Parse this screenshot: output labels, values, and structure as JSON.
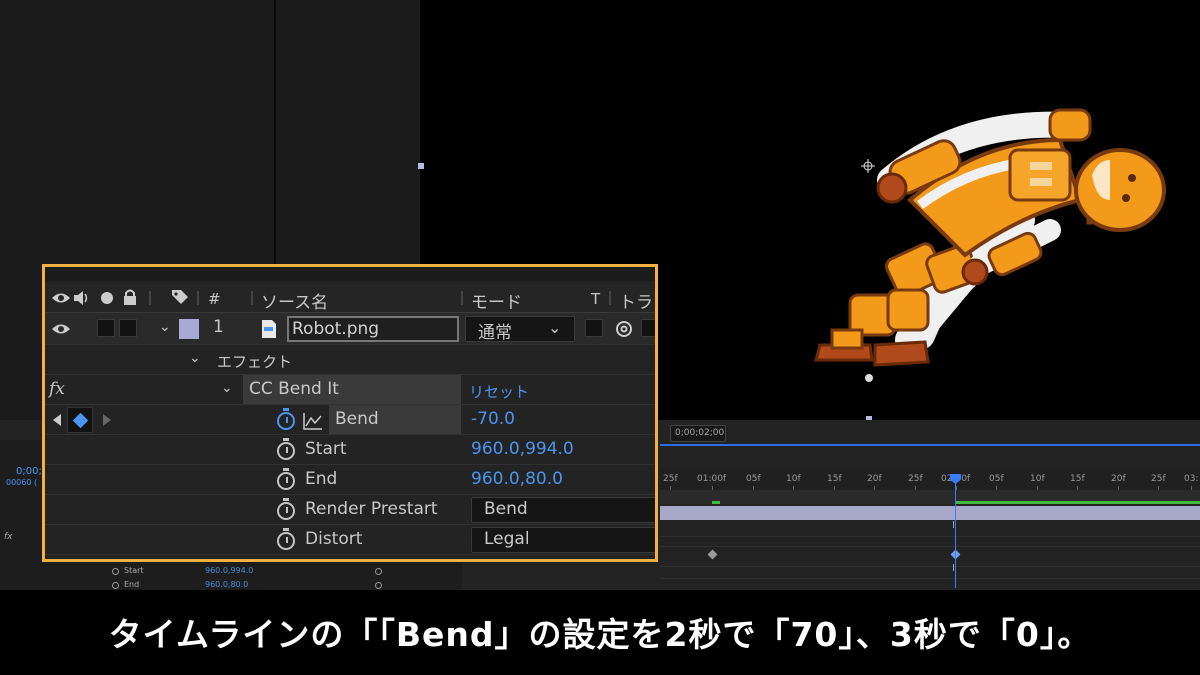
{
  "header": {
    "col_source_name": "ソース名",
    "col_mode": "モード",
    "col_t": "T",
    "col_track": "トラ",
    "col_number": "#"
  },
  "layer": {
    "number": "1",
    "name": "Robot.png",
    "mode": "通常",
    "label_color": "#a9a9d6"
  },
  "effects_group": {
    "label": "エフェクト"
  },
  "effect": {
    "fx_label": "fx",
    "name": "CC Bend It",
    "reset_label": "リセット"
  },
  "properties": [
    {
      "label": "Bend",
      "value": "-70.0"
    },
    {
      "label": "Start",
      "value": "960.0,994.0"
    },
    {
      "label": "End",
      "value": "960.0,80.0"
    },
    {
      "label": "Render Prestart",
      "value": "Bend"
    },
    {
      "label": "Distort",
      "value": "Legal"
    }
  ],
  "timeline": {
    "timecode_box": "0;00;02;00",
    "ruler_ticks": [
      "25f",
      "01:00f",
      "05f",
      "10f",
      "15f",
      "20f",
      "25f",
      "02:00f",
      "05f",
      "10f",
      "15f",
      "20f",
      "25f",
      "03:"
    ],
    "left_timecode": "0;00;",
    "left_frames": "00060 (",
    "bg_start_label": "Start",
    "bg_start_value": "960.0,994.0",
    "bg_end_label": "End",
    "bg_end_value": "960.0,80.0",
    "bg_fx_label": "fx"
  },
  "caption": "タイムラインの「「Bend」の設定を2秒で「70」、3秒で「0」。",
  "colors": {
    "accent_blue": "#4a95f0",
    "zoom_border": "#f4b142",
    "robot_orange": "#f39a1a"
  }
}
